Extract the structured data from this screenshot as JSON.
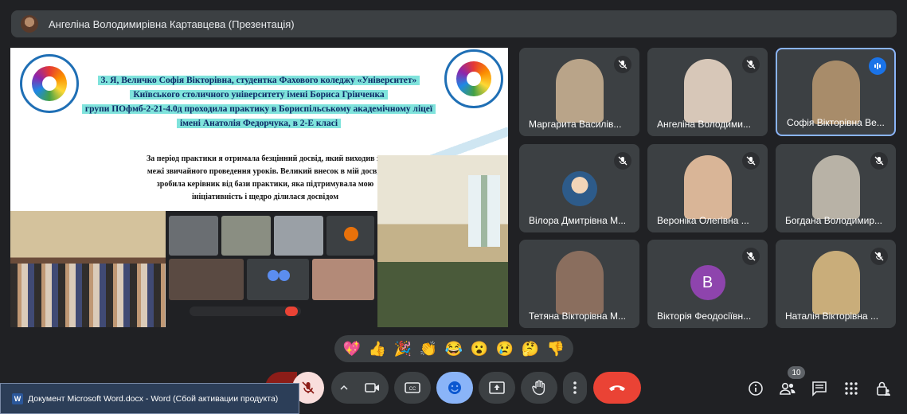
{
  "header": {
    "presenter_title": "Ангеліна Володимирівна Картавцева (Презентація)"
  },
  "slide": {
    "heading": [
      "3.  Я, Величко Софія Вікторівна, студентка Фахового коледжу «Університет»",
      "Київського столичного університету імені Бориса Грінченка",
      "групи ПОфмб-2-21-4.0д проходила практику в Бориспільському академічному ліцеї",
      "імені Анатолія Федорчука, в 2-Е класі"
    ],
    "body": "За період практики я отримала безцінний досвід, який виходив за межі звичайного проведення уроків. Великий внесок в мій досвід зробила керівник від бази практики, яка підтримувала мою ініціативність і щедро ділилася досвідом",
    "logo_left_text": "КИЇВСЬКИЙ СТОЛИЧНИЙ УНІВЕРСИТЕТ ІМЕНІ БОРИСА ГРІНЧЕНКА",
    "logo_right_text": "ФАХОВИЙ КОЛЕДЖ «УНІВЕРСУМ»"
  },
  "participants": [
    {
      "name": "Маргарита Василів...",
      "muted": true,
      "speaking": false,
      "kind": "video",
      "color": "#b9a489"
    },
    {
      "name": "Ангеліна Володими...",
      "muted": true,
      "speaking": false,
      "kind": "video",
      "color": "#d7c7b8"
    },
    {
      "name": "Софія Вікторівна Ве...",
      "muted": false,
      "speaking": true,
      "kind": "video",
      "color": "#a88c6a"
    },
    {
      "name": "Вілора Дмитрівна М...",
      "muted": true,
      "speaking": false,
      "kind": "avatar",
      "color": "#3c4043"
    },
    {
      "name": "Вероніка Олегівна ...",
      "muted": true,
      "speaking": false,
      "kind": "video",
      "color": "#d9b597"
    },
    {
      "name": "Богдана Володимир...",
      "muted": true,
      "speaking": false,
      "kind": "video",
      "color": "#b8b2a6"
    },
    {
      "name": "Тетяна Вікторівна М...",
      "muted": false,
      "speaking": false,
      "kind": "video",
      "color": "#8a6e5e"
    },
    {
      "name": "Вікторія Феодосіївн...",
      "muted": true,
      "speaking": false,
      "kind": "letter",
      "letter": "В",
      "color": "#3c4043"
    },
    {
      "name": "Наталія Вікторівна ...",
      "muted": true,
      "speaking": false,
      "kind": "video",
      "color": "#c9ad7a"
    }
  ],
  "reactions": [
    "💖",
    "👍",
    "🎉",
    "👏",
    "😂",
    "😮",
    "😢",
    "🤔",
    "👎"
  ],
  "controls": {
    "people_count": "10"
  },
  "taskbar": {
    "word_icon_label": "W",
    "window_title": "Документ Microsoft Word.docx - Word (Сбой активации продукта)"
  },
  "colors": {
    "background": "#202124",
    "tile": "#3c4043",
    "hangup": "#ea4335",
    "active_border": "#8ab4f8",
    "slide_highlight": "#7fe3dc"
  }
}
